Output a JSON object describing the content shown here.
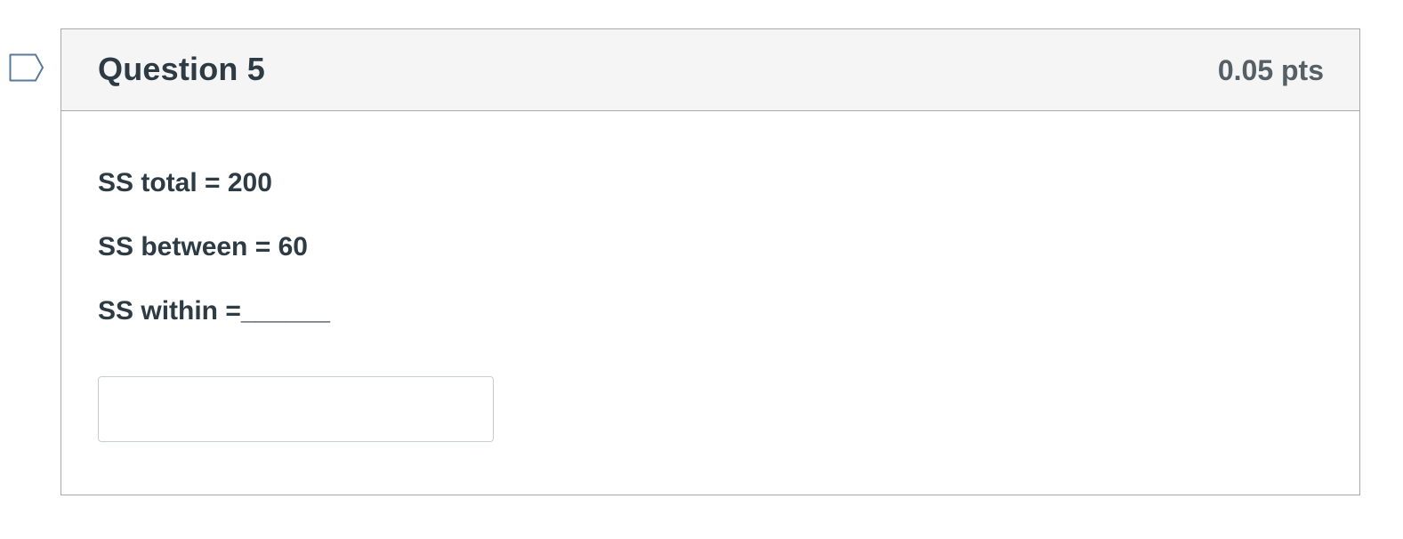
{
  "question": {
    "title": "Question 5",
    "points": "0.05 pts",
    "flag_icon": "flag-bookmark-icon",
    "lines": [
      "SS total = 200",
      "SS between = 60",
      "SS within =______"
    ],
    "answer": {
      "value": "",
      "placeholder": ""
    }
  },
  "colors": {
    "header_background": "#f5f5f5",
    "border": "#a9a9a9",
    "text": "#2d3b45",
    "points_text": "#555f66",
    "flag_outline": "#5a7a99"
  }
}
